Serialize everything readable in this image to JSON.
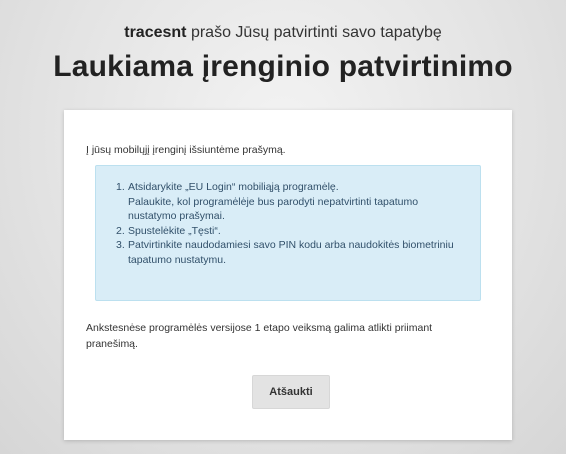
{
  "header": {
    "app_name": "tracesnt",
    "subtitle_rest": " prašo Jūsų patvirtinti savo tapatybę",
    "title": "Laukiama įrenginio patvirtinimo"
  },
  "card": {
    "intro": "Į jūsų mobilųjį įrenginį išsiuntėme prašymą.",
    "steps": [
      {
        "num": "1.",
        "text": "Atsidarykite „EU Login“ mobiliąją programėlę.",
        "subtext": "Palaukite, kol programėlėje bus parodyti nepatvirtinti tapatumo nustatymo prašymai."
      },
      {
        "num": "2.",
        "text": "Spustelėkite „Tęsti“."
      },
      {
        "num": "3.",
        "text": "Patvirtinkite naudodamiesi savo PIN kodu arba naudokitės biometriniu tapatumo nustatymu."
      }
    ],
    "note": "Ankstesnėse programėlės versijose 1 etapo veiksmą galima atlikti priimant pranešimą.",
    "cancel_label": "Atšaukti"
  },
  "colors": {
    "info_bg": "#d9edf7",
    "info_text": "#31506a",
    "button_bg": "#e3e3e3"
  }
}
